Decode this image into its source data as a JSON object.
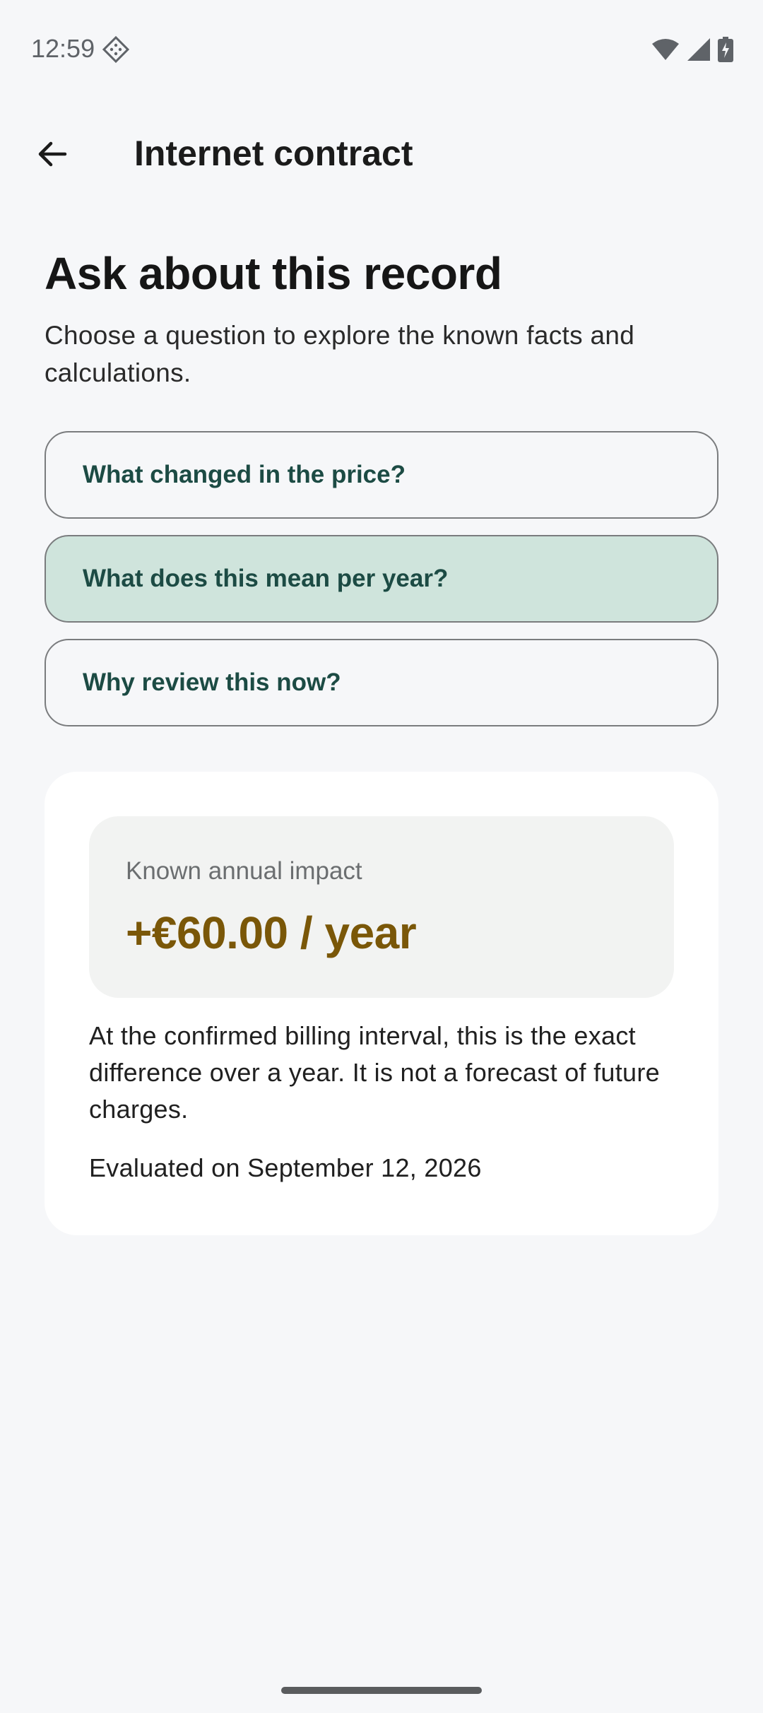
{
  "status_bar": {
    "time": "12:59",
    "icons": [
      "notification-badge-icon",
      "wifi-icon",
      "cell-signal-icon",
      "battery-charging-icon"
    ]
  },
  "app_bar": {
    "back_icon": "arrow-back-icon",
    "title": "Internet contract"
  },
  "page": {
    "heading": "Ask about this record",
    "subtitle": "Choose a question to explore the known facts and calculations."
  },
  "questions": [
    {
      "label": "What changed in the price?",
      "selected": false
    },
    {
      "label": "What does this mean per year?",
      "selected": true
    },
    {
      "label": "Why review this now?",
      "selected": false
    }
  ],
  "answer": {
    "impact_label": "Known annual impact",
    "impact_value": "+€60.00 / year",
    "explanation": "At the confirmed billing interval, this is the exact difference over a year. It is not a forecast of future charges.",
    "evaluated": "Evaluated on September 12, 2026"
  },
  "colors": {
    "accent_text": "#1c4b44",
    "selected_bg": "#cfe4dc",
    "impact_value": "#7a5708",
    "background": "#f6f7f9"
  }
}
